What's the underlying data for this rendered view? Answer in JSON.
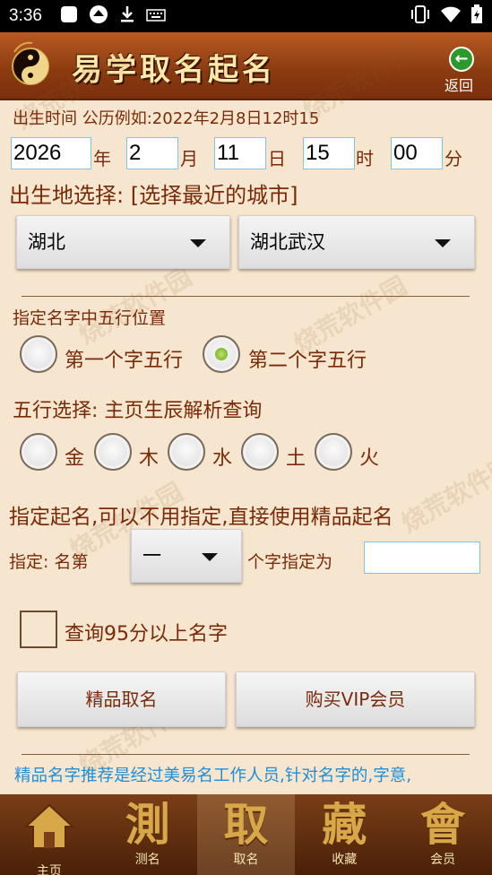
{
  "status_bar": {
    "time": "3:36",
    "left_icons": [
      "square-icon",
      "app-icon",
      "download-icon",
      "keyboard-icon"
    ],
    "right_icons": [
      "vibrate-icon",
      "wifi-icon",
      "battery-icon"
    ]
  },
  "header": {
    "title": "易学取名起名",
    "back_label": "返回"
  },
  "birth": {
    "label": "出生时间 公历例如:2022年2月8日12时15",
    "year": "2026",
    "year_unit": "年",
    "month": "2",
    "month_unit": "月",
    "day": "11",
    "day_unit": "日",
    "hour": "15",
    "hour_unit": "时",
    "minute": "00",
    "minute_unit": "分"
  },
  "place": {
    "label": "出生地选择: [选择最近的城市]",
    "province": "湖北",
    "city": "湖北武汉"
  },
  "wuxing_position": {
    "label": "指定名字中五行位置",
    "options": [
      "第一个字五行",
      "第二个字五行"
    ],
    "selected": 1
  },
  "wuxing_select": {
    "label": "五行选择: 主页生辰解析查询",
    "options": [
      "金",
      "木",
      "水",
      "土",
      "火"
    ]
  },
  "specify": {
    "heading": "指定起名,可以不用指定,直接使用精品起名",
    "label_prefix": "指定: 名第",
    "position_value": "一",
    "label_suffix": "个字指定为",
    "char_value": ""
  },
  "filter": {
    "label": "查询95分以上名字",
    "checked": false
  },
  "actions": {
    "premium_button": "精品取名",
    "vip_button": "购买VIP会员"
  },
  "info_text": "精品名字推荐是经过美易名工作人员,针对名字的,字意,",
  "watermark": "烧荒软件园",
  "bottom_nav": [
    {
      "glyph": "⌂",
      "label": "主页"
    },
    {
      "glyph": "測",
      "label": "测名"
    },
    {
      "glyph": "取",
      "label": "取名"
    },
    {
      "glyph": "藏",
      "label": "收藏"
    },
    {
      "glyph": "會",
      "label": "会员"
    }
  ],
  "colors": {
    "header_bg": "#8a3a10",
    "page_bg": "#f7e6cf",
    "text_brown": "#7a2a08",
    "info_blue": "#1e8fd8",
    "radio_selected": "#6aa818"
  }
}
